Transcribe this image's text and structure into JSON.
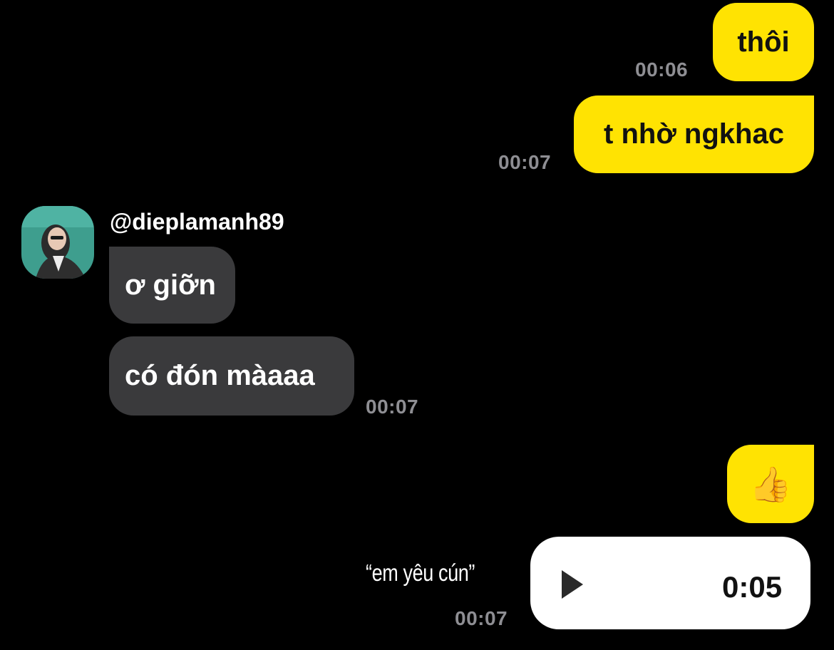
{
  "colors": {
    "background": "#000000",
    "outgoing_bubble": "#FFE302",
    "incoming_bubble": "#3A3A3C",
    "timestamp": "#8E8E93",
    "voice_bubble": "#FFFFFF"
  },
  "messages": {
    "out1": {
      "text": "thôi",
      "time": "00:06"
    },
    "out2": {
      "text": "t nhờ ngkhac",
      "time": "00:07"
    },
    "incoming": {
      "username": "@dieplamanh89",
      "avatar": "avatar-photo",
      "msg1": {
        "text": "ơ giỡn"
      },
      "msg2": {
        "text": "có đón màaaa",
        "time": "00:07"
      }
    },
    "out3": {
      "text": "👍"
    },
    "voice": {
      "caption": "“em yêu cún”",
      "duration": "0:05",
      "time": "00:07",
      "icon": "play-icon"
    }
  }
}
